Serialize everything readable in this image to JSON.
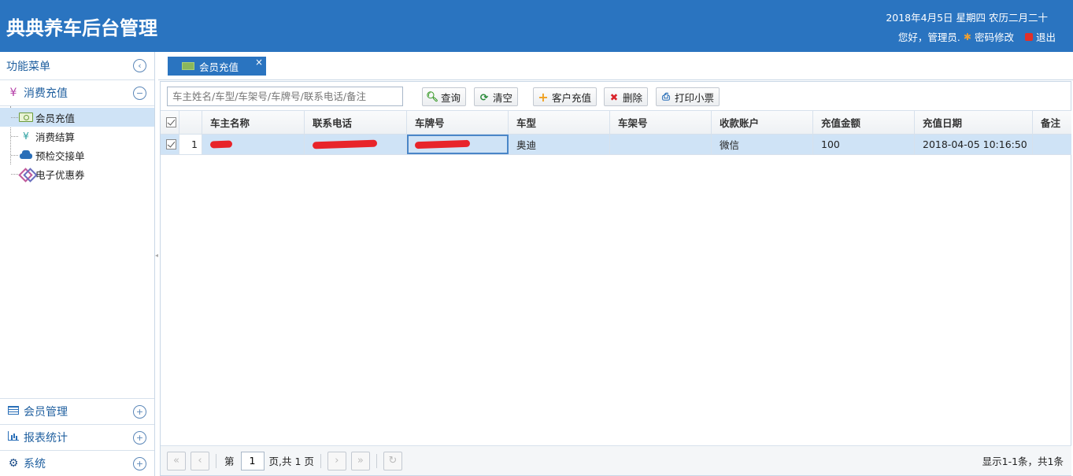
{
  "header": {
    "app_title": "典典养车后台管理",
    "date_text": "2018年4月5日 星期四 农历二月二十",
    "greeting": "您好，管理员.",
    "change_password": "密码修改",
    "logout": "退出"
  },
  "sidebar": {
    "title": "功能菜单",
    "active_section": {
      "label": "消费充值",
      "items": [
        {
          "label": "会员充值",
          "icon": "money-icon"
        },
        {
          "label": "消费结算",
          "icon": "yen-icon"
        },
        {
          "label": "预检交接单",
          "icon": "car-icon"
        },
        {
          "label": "电子优惠券",
          "icon": "coupon-icon"
        }
      ]
    },
    "bottom_sections": [
      {
        "label": "会员管理",
        "icon": "list-icon"
      },
      {
        "label": "报表统计",
        "icon": "bar-chart-icon"
      },
      {
        "label": "系统",
        "icon": "gear-icon"
      }
    ]
  },
  "tabs": [
    {
      "label": "会员充值",
      "close": "×"
    }
  ],
  "toolbar": {
    "search_placeholder": "车主姓名/车型/车架号/车牌号/联系电话/备注",
    "query": "查询",
    "clear": "清空",
    "recharge": "客户充值",
    "delete": "删除",
    "print": "打印小票"
  },
  "table": {
    "columns": [
      "车主名称",
      "联系电话",
      "车牌号",
      "车型",
      "车架号",
      "收款账户",
      "充值金额",
      "充值日期",
      "备注"
    ],
    "rows": [
      {
        "num": "1",
        "owner": "",
        "phone": "",
        "plate": "",
        "model": "奥迪",
        "vin": "",
        "account": "微信",
        "amount": "100",
        "date": "2018-04-05 10:16:50",
        "note": ""
      }
    ]
  },
  "pager": {
    "page_label": "第",
    "page_value": "1",
    "page_suffix": "页,共 1 页",
    "info": "显示1-1条，共1条"
  },
  "colors": {
    "header_bg": "#2a74c0",
    "selected_row": "#cfe3f6",
    "redaction": "#e8242a"
  }
}
